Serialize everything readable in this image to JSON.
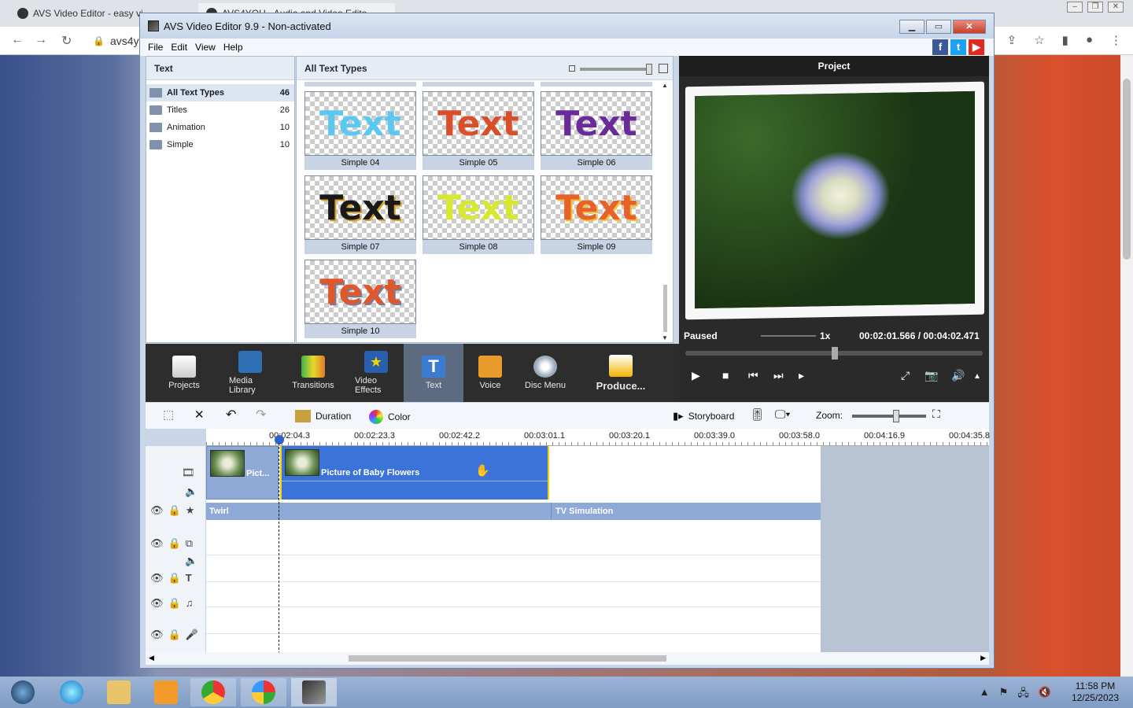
{
  "browser": {
    "tab1_title": "AVS Video Editor - easy vi...",
    "tab2_title": "AVS4YOU - Audio and Video Edito...",
    "url": "avs4y"
  },
  "window": {
    "title": "AVS Video Editor 9.9 - Non-activated",
    "menu": [
      "File",
      "Edit",
      "View",
      "Help"
    ]
  },
  "left_panel": {
    "header": "Text",
    "categories": [
      {
        "label": "All Text Types",
        "count": "46"
      },
      {
        "label": "Titles",
        "count": "26"
      },
      {
        "label": "Animation",
        "count": "10"
      },
      {
        "label": "Simple",
        "count": "10"
      }
    ]
  },
  "grid_panel": {
    "header": "All Text Types",
    "tiles": [
      {
        "caption": "Simple 04",
        "sample": "Text",
        "color": "#5ac8f0"
      },
      {
        "caption": "Simple 05",
        "sample": "Text",
        "color": "#d8502a"
      },
      {
        "caption": "Simple 06",
        "sample": "Text",
        "color": "#6a2a9a"
      },
      {
        "caption": "Simple 07",
        "sample": "Text",
        "color": "#1a1a1a"
      },
      {
        "caption": "Simple 08",
        "sample": "Text",
        "color": "#d6e830"
      },
      {
        "caption": "Simple 09",
        "sample": "Text",
        "color": "#e8602a"
      },
      {
        "caption": "Simple 10",
        "sample": "Text",
        "color": "#e0582a"
      }
    ]
  },
  "preview": {
    "header": "Project",
    "status": "Paused",
    "speed": "1x",
    "time": "00:02:01.566 / 00:04:02.471"
  },
  "toolbar": [
    {
      "label": "Projects",
      "icon": "clapper-icon"
    },
    {
      "label": "Media Library",
      "icon": "film-icon"
    },
    {
      "label": "Transitions",
      "icon": "transition-icon"
    },
    {
      "label": "Video Effects",
      "icon": "star-icon"
    },
    {
      "label": "Text",
      "icon": "text-icon"
    },
    {
      "label": "Voice",
      "icon": "microphone-icon"
    },
    {
      "label": "Disc Menu",
      "icon": "disc-icon"
    },
    {
      "label": "Produce...",
      "icon": "produce-icon"
    }
  ],
  "timeline_tools": {
    "duration": "Duration",
    "color": "Color",
    "storyboard": "Storyboard",
    "zoom": "Zoom:"
  },
  "ruler": [
    "00:02:04.3",
    "00:02:23.3",
    "00:02:42.2",
    "00:03:01.1",
    "00:03:20.1",
    "00:03:39.0",
    "00:03:58.0",
    "00:04:16.9",
    "00:04:35.8"
  ],
  "clips": {
    "clip1": "Pict...",
    "clip2": "Picture of Baby Flowers",
    "effect1": "Twirl",
    "effect2": "TV Simulation"
  },
  "taskbar": {
    "time": "11:58 PM",
    "date": "12/25/2023"
  }
}
